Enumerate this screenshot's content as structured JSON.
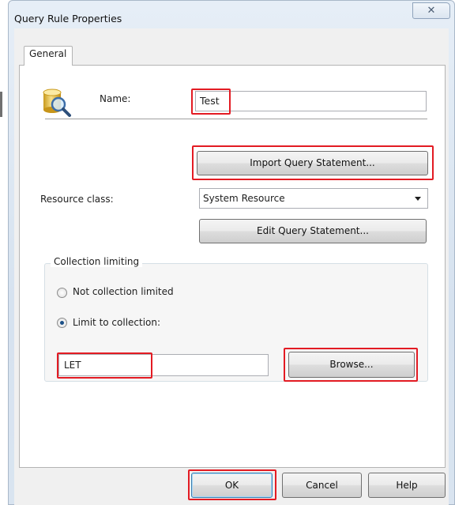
{
  "window": {
    "title": "Query Rule Properties",
    "close_glyph": "✕"
  },
  "tabs": [
    {
      "label": "General"
    }
  ],
  "general": {
    "name_label": "Name:",
    "name_value": "Test",
    "import_button": "Import Query Statement...",
    "resource_class_label": "Resource class:",
    "resource_class_selected": "System Resource",
    "edit_button": "Edit Query Statement...",
    "collection_group_label": "Collection limiting",
    "radio_not_limited": "Not collection limited",
    "radio_limit": "Limit to collection:",
    "collection_value": "LET",
    "browse_button": "Browse..."
  },
  "footer": {
    "ok": "OK",
    "cancel": "Cancel",
    "help": "Help"
  },
  "icons": {
    "rule": "database-search-icon",
    "close": "close-icon",
    "dropdown": "chevron-down-icon"
  },
  "colors": {
    "highlight": "#e31b23",
    "title_bar": "#d6e2ef"
  }
}
